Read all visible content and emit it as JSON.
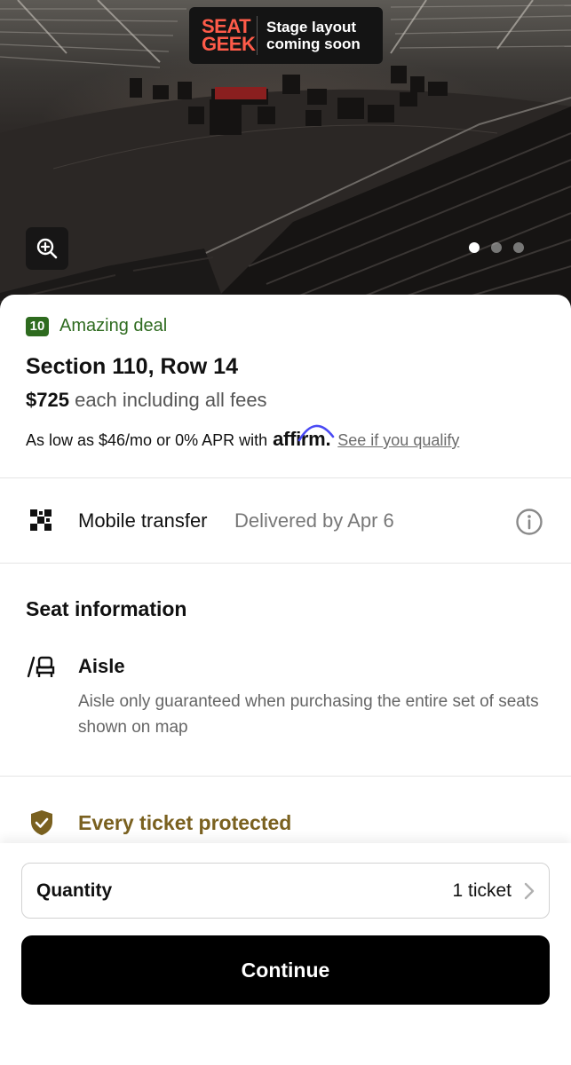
{
  "hero": {
    "brand_logo_line1": "SEAT",
    "brand_logo_line2": "GEEK",
    "brand_badge_line1": "Stage layout",
    "brand_badge_line2": "coming soon",
    "zoom_icon": "zoom-in-icon",
    "carousel": {
      "count": 3,
      "active_index": 0
    }
  },
  "listing": {
    "deal_score": "10",
    "deal_label": "Amazing deal",
    "section_row": "Section 110, Row 14",
    "price": "$725",
    "price_suffix": "each including all fees",
    "finance_prefix": "As low as $46/mo or 0% APR with",
    "finance_brand": "affirm",
    "finance_suffix": ".",
    "finance_link": "See if you qualify"
  },
  "delivery": {
    "method": "Mobile transfer",
    "date": "Delivered by Apr 6",
    "icon": "qr-code-icon",
    "info_icon": "info-icon"
  },
  "seat_info": {
    "heading": "Seat information",
    "feature_title": "Aisle",
    "feature_description": "Aisle only guaranteed when purchasing the entire set of seats shown on map",
    "feature_icon": "aisle-seat-icon"
  },
  "protection": {
    "label": "Every ticket protected",
    "icon": "shield-check-icon"
  },
  "footer": {
    "quantity_label": "Quantity",
    "quantity_value": "1 ticket",
    "continue_label": "Continue"
  },
  "colors": {
    "deal_green": "#2e6b1f",
    "protect_gold": "#7a6120",
    "brand_coral": "#ff5b49",
    "button_black": "#000000"
  }
}
